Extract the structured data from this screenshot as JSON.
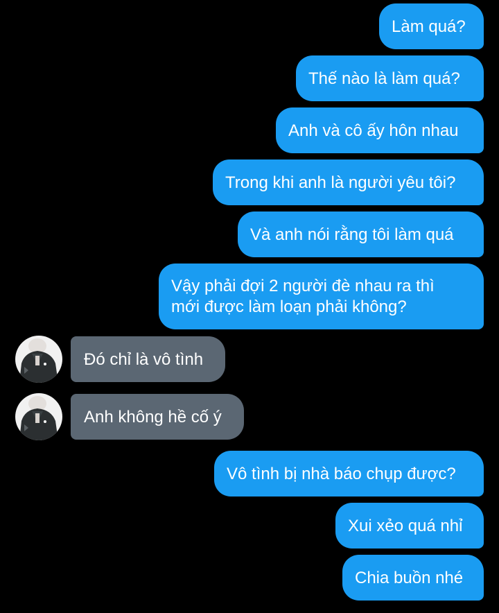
{
  "conversation": {
    "accent_color": "#1a9cf2",
    "incoming_color": "#5b6773",
    "background_color": "#000000",
    "contact_avatar_icon": "person-in-hooded-jacket-avatar",
    "messages": [
      {
        "direction": "outgoing",
        "text": "Làm quá?"
      },
      {
        "direction": "outgoing",
        "text": "Thế nào là làm quá?"
      },
      {
        "direction": "outgoing",
        "text": "Anh và cô ấy hôn nhau"
      },
      {
        "direction": "outgoing",
        "text": "Trong khi anh là người yêu tôi?"
      },
      {
        "direction": "outgoing",
        "text": "Và anh nói rằng tôi làm quá"
      },
      {
        "direction": "outgoing",
        "text": "Vậy phải đợi 2 người đè nhau ra thì mới được làm loạn phải không?"
      },
      {
        "direction": "incoming",
        "text": "Đó chỉ là vô tình"
      },
      {
        "direction": "incoming",
        "text": "Anh không hề cố ý"
      },
      {
        "direction": "outgoing",
        "text": "Vô tình bị nhà báo chụp được?"
      },
      {
        "direction": "outgoing",
        "text": "Xui xẻo quá nhỉ"
      },
      {
        "direction": "outgoing",
        "text": "Chia buồn nhé"
      }
    ]
  }
}
